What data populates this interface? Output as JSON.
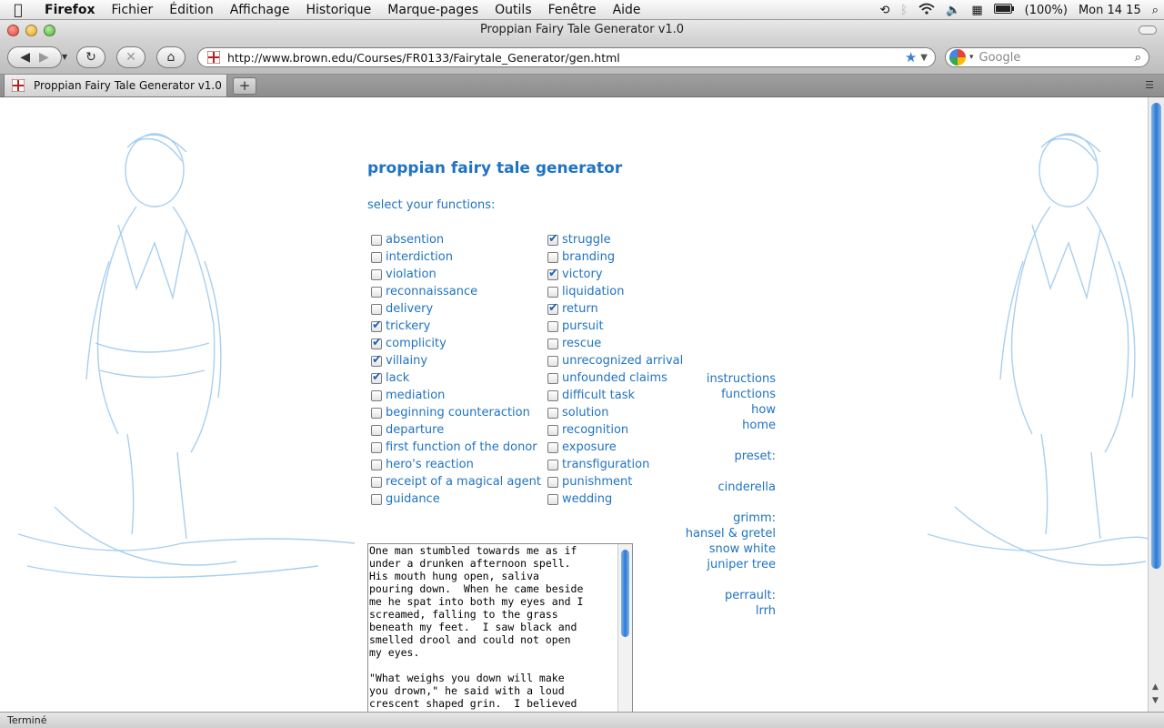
{
  "menubar": {
    "items": [
      "Firefox",
      "Fichier",
      "Édition",
      "Affichage",
      "Historique",
      "Marque-pages",
      "Outils",
      "Fenêtre",
      "Aide"
    ],
    "battery": "(100%)",
    "clock": "Mon 14 15"
  },
  "window": {
    "title": "Proppian Fairy Tale Generator v1.0"
  },
  "toolbar": {
    "url": "http://www.brown.edu/Courses/FR0133/Fairytale_Generator/gen.html",
    "search_placeholder": "Google"
  },
  "tab": {
    "label": "Proppian Fairy Tale Generator v1.0"
  },
  "page": {
    "title": "proppian fairy tale generator",
    "select_label": "select your functions:",
    "functions_col1": [
      {
        "label": "absention",
        "checked": false
      },
      {
        "label": "interdiction",
        "checked": false
      },
      {
        "label": "violation",
        "checked": false
      },
      {
        "label": "reconnaissance",
        "checked": false
      },
      {
        "label": "delivery",
        "checked": false
      },
      {
        "label": "trickery",
        "checked": true
      },
      {
        "label": "complicity",
        "checked": true
      },
      {
        "label": "villainy",
        "checked": true
      },
      {
        "label": "lack",
        "checked": true
      },
      {
        "label": "mediation",
        "checked": false
      },
      {
        "label": "beginning counteraction",
        "checked": false
      },
      {
        "label": "departure",
        "checked": false
      },
      {
        "label": "first function of the donor",
        "checked": false
      },
      {
        "label": "hero's reaction",
        "checked": false
      },
      {
        "label": "receipt of a magical agent",
        "checked": false
      },
      {
        "label": "guidance",
        "checked": false
      }
    ],
    "functions_col2": [
      {
        "label": "struggle",
        "checked": true
      },
      {
        "label": "branding",
        "checked": false
      },
      {
        "label": "victory",
        "checked": true
      },
      {
        "label": "liquidation",
        "checked": false
      },
      {
        "label": "return",
        "checked": true
      },
      {
        "label": "pursuit",
        "checked": false
      },
      {
        "label": "rescue",
        "checked": false
      },
      {
        "label": "unrecognized arrival",
        "checked": false
      },
      {
        "label": "unfounded claims",
        "checked": false
      },
      {
        "label": "difficult task",
        "checked": false
      },
      {
        "label": "solution",
        "checked": false
      },
      {
        "label": "recognition",
        "checked": false
      },
      {
        "label": "exposure",
        "checked": false
      },
      {
        "label": "transfiguration",
        "checked": false
      },
      {
        "label": "punishment",
        "checked": false
      },
      {
        "label": "wedding",
        "checked": false
      }
    ],
    "side_nav": {
      "instructions": "instructions",
      "functions": "functions",
      "how": "how",
      "home": "home",
      "preset_label": "preset:",
      "cinderella": "cinderella",
      "grimm_label": "grimm:",
      "hansel": "hansel & gretel",
      "snow_white": "snow white",
      "juniper": "juniper tree",
      "perrault_label": "perrault:",
      "lrrh": "lrrh"
    },
    "story_text": "One man stumbled towards me as if\nunder a drunken afternoon spell.\nHis mouth hung open, saliva\npouring down.  When he came beside\nme he spat into both my eyes and I\nscreamed, falling to the grass\nbeneath my feet.  I saw black and\nsmelled drool and could not open\nmy eyes.\n\n\"What weighs you down will make\nyou drown,\" he said with a loud\ncrescent shaped grin.  I believed"
  },
  "status": {
    "text": "Terminé"
  },
  "colors": {
    "link_blue": "#1f73c2",
    "sketch_blue": "#a8cff0"
  }
}
